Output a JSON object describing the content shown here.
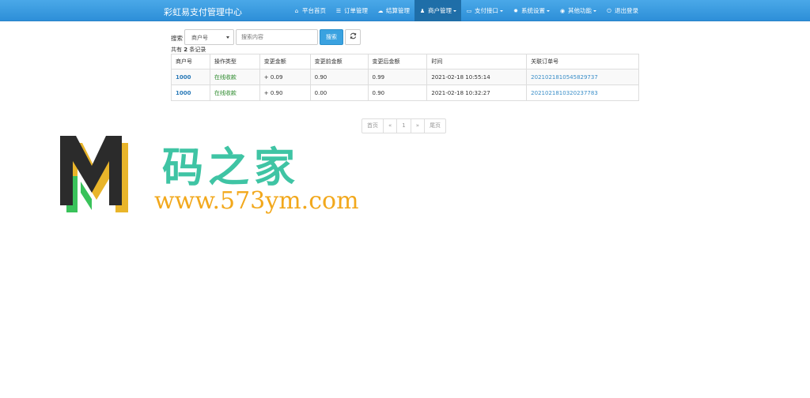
{
  "app": {
    "title": "彩虹易支付管理中心"
  },
  "nav": {
    "items": [
      {
        "label": "平台首页",
        "icon": "home-icon",
        "glyph": "⌂",
        "dropdown": false,
        "active": false
      },
      {
        "label": "订单管理",
        "icon": "list-icon",
        "glyph": "☰",
        "dropdown": false,
        "active": false
      },
      {
        "label": "结算管理",
        "icon": "cloud-icon",
        "glyph": "☁",
        "dropdown": false,
        "active": false
      },
      {
        "label": "商户管理",
        "icon": "user-icon",
        "glyph": "♟",
        "dropdown": true,
        "active": true
      },
      {
        "label": "支付接口",
        "icon": "credit-card-icon",
        "glyph": "▭",
        "dropdown": true,
        "active": false
      },
      {
        "label": "系统设置",
        "icon": "gear-icon",
        "glyph": "✹",
        "dropdown": true,
        "active": false
      },
      {
        "label": "其他功能",
        "icon": "globe-icon",
        "glyph": "◉",
        "dropdown": true,
        "active": false
      },
      {
        "label": "退出登录",
        "icon": "power-icon",
        "glyph": "⏻",
        "dropdown": false,
        "active": false
      }
    ]
  },
  "search": {
    "label": "搜索",
    "field_value": "商户号",
    "placeholder": "搜索内容",
    "button_label": "搜索",
    "refresh_icon": "refresh-icon"
  },
  "records": {
    "prefix": "共有 ",
    "count": "2",
    "suffix": " 条记录"
  },
  "table": {
    "columns": [
      "商户号",
      "操作类型",
      "变更金额",
      "变更前金额",
      "变更后金额",
      "时间",
      "关联订单号"
    ],
    "rows": [
      [
        "1000",
        "在线收款",
        "+ 0.09",
        "0.90",
        "0.99",
        "2021-02-18 10:55:14",
        "2021021810545829737"
      ],
      [
        "1000",
        "在线收款",
        "+ 0.90",
        "0.00",
        "0.90",
        "2021-02-18 10:32:27",
        "2021021810320237783"
      ]
    ]
  },
  "pagination": {
    "first": "首页",
    "prev": "«",
    "current": "1",
    "next": "»",
    "last": "尾页"
  },
  "watermark": {
    "title": "码之家",
    "url": "www.573ym.com"
  },
  "colors": {
    "navbar": "#2d8fd8",
    "nav_active": "#1f6ea8",
    "primary_button": "#3aa2e0",
    "link": "#3a8ec8",
    "type_green": "#2e8b2e",
    "watermark_title": "#3fc4a4",
    "watermark_url": "#f2a81c"
  }
}
